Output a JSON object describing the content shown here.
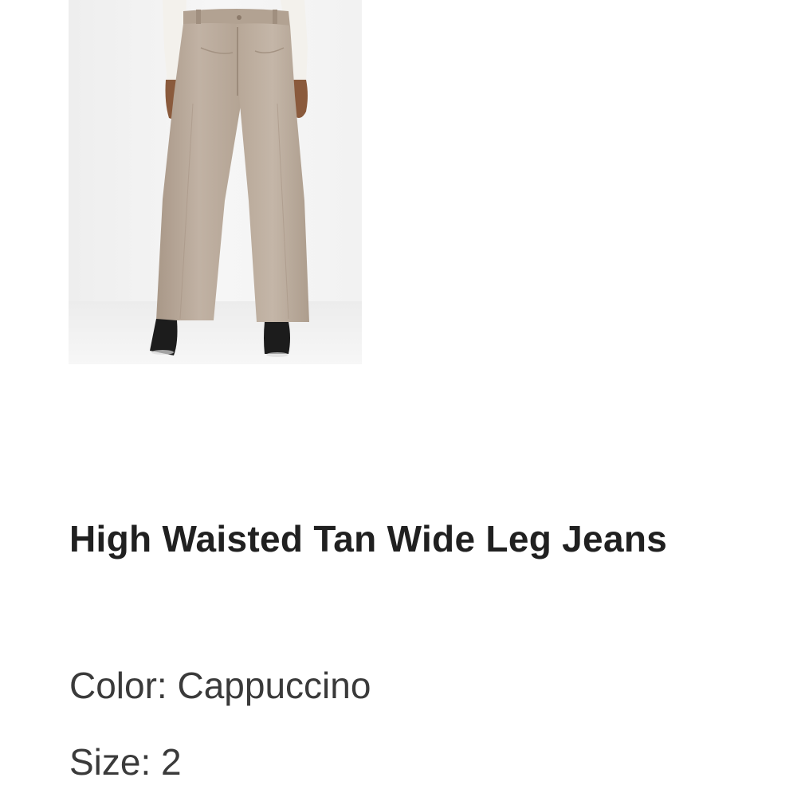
{
  "product": {
    "image_alt": "Model wearing high waisted tan wide leg jeans with a white top and black heeled boots",
    "title": "High Waisted Tan Wide Leg Jeans",
    "color_label": "Color:",
    "color_value": "Cappuccino",
    "size_label": "Size:",
    "size_value": "2"
  },
  "colors": {
    "text_primary": "#202020",
    "text_secondary": "#3a3a3a",
    "denim": "#b9aa9c",
    "background": "#ffffff"
  }
}
